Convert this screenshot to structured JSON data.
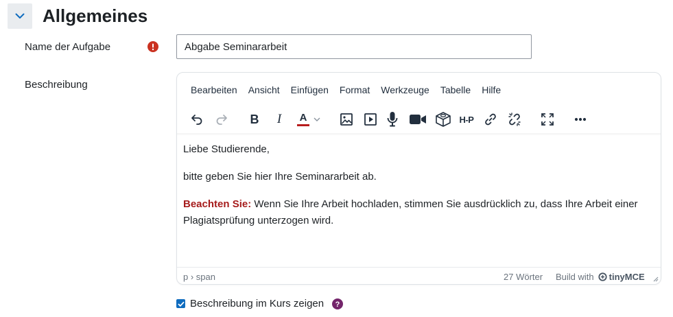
{
  "section": {
    "title": "Allgemeines",
    "toggle_icon": "chevron-down-icon"
  },
  "fields": {
    "name": {
      "label": "Name der Aufgabe",
      "value": "Abgabe Seminararbeit",
      "required_icon": "exclamation-circle-icon"
    },
    "description": {
      "label": "Beschreibung"
    }
  },
  "editor": {
    "menu": [
      "Bearbeiten",
      "Ansicht",
      "Einfügen",
      "Format",
      "Werkzeuge",
      "Tabelle",
      "Hilfe"
    ],
    "toolbar": {
      "undo_icon": "undo-icon",
      "redo_icon": "redo-icon",
      "bold_label": "B",
      "italic_label": "I",
      "text_color_label": "A",
      "text_color": "#b71c1c",
      "h5p_label": "H-P"
    },
    "content": {
      "p1": "Liebe Studierende,",
      "p2": "bitte geben Sie hier Ihre Seminararbeit ab.",
      "p3_bold": "Beachten Sie:",
      "p3_text": " Wenn Sie Ihre Arbeit hochladen, stimmen Sie ausdrücklich zu, dass Ihre Arbeit einer Plagiatsprüfung unterzogen wird."
    },
    "status": {
      "path": "p › span",
      "words": "27 Wörter",
      "brand_prefix": "Build with",
      "brand_name": "tinyMCE"
    }
  },
  "checkbox": {
    "label": "Beschreibung im Kurs zeigen",
    "checked": true,
    "help_icon": "question-circle-icon"
  },
  "colors": {
    "required": "#ca3120",
    "help": "#74256b",
    "checkbox": "#0f6cbf",
    "warning_text": "#a61c1c"
  }
}
